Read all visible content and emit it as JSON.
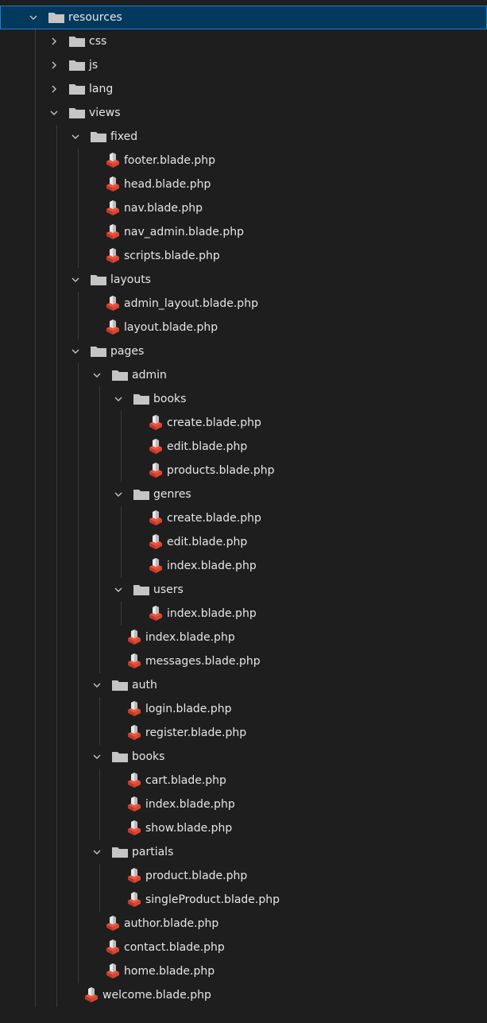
{
  "explorer": {
    "items": [
      {
        "label": "resources",
        "kind": "folder",
        "depth": 0,
        "expanded": true,
        "selected": true
      },
      {
        "label": "css",
        "kind": "folder",
        "depth": 1,
        "expanded": false
      },
      {
        "label": "js",
        "kind": "folder",
        "depth": 1,
        "expanded": false
      },
      {
        "label": "lang",
        "kind": "folder",
        "depth": 1,
        "expanded": false
      },
      {
        "label": "views",
        "kind": "folder",
        "depth": 1,
        "expanded": true
      },
      {
        "label": "fixed",
        "kind": "folder",
        "depth": 2,
        "expanded": true
      },
      {
        "label": "footer.blade.php",
        "kind": "file",
        "depth": 3
      },
      {
        "label": "head.blade.php",
        "kind": "file",
        "depth": 3
      },
      {
        "label": "nav.blade.php",
        "kind": "file",
        "depth": 3
      },
      {
        "label": "nav_admin.blade.php",
        "kind": "file",
        "depth": 3
      },
      {
        "label": "scripts.blade.php",
        "kind": "file",
        "depth": 3
      },
      {
        "label": "layouts",
        "kind": "folder",
        "depth": 2,
        "expanded": true
      },
      {
        "label": "admin_layout.blade.php",
        "kind": "file",
        "depth": 3
      },
      {
        "label": "layout.blade.php",
        "kind": "file",
        "depth": 3
      },
      {
        "label": "pages",
        "kind": "folder",
        "depth": 2,
        "expanded": true
      },
      {
        "label": "admin",
        "kind": "folder",
        "depth": 3,
        "expanded": true
      },
      {
        "label": "books",
        "kind": "folder",
        "depth": 4,
        "expanded": true
      },
      {
        "label": "create.blade.php",
        "kind": "file",
        "depth": 5
      },
      {
        "label": "edit.blade.php",
        "kind": "file",
        "depth": 5
      },
      {
        "label": "products.blade.php",
        "kind": "file",
        "depth": 5
      },
      {
        "label": "genres",
        "kind": "folder",
        "depth": 4,
        "expanded": true
      },
      {
        "label": "create.blade.php",
        "kind": "file",
        "depth": 5
      },
      {
        "label": "edit.blade.php",
        "kind": "file",
        "depth": 5
      },
      {
        "label": "index.blade.php",
        "kind": "file",
        "depth": 5
      },
      {
        "label": "users",
        "kind": "folder",
        "depth": 4,
        "expanded": true
      },
      {
        "label": "index.blade.php",
        "kind": "file",
        "depth": 5
      },
      {
        "label": "index.blade.php",
        "kind": "file",
        "depth": 4
      },
      {
        "label": "messages.blade.php",
        "kind": "file",
        "depth": 4
      },
      {
        "label": "auth",
        "kind": "folder",
        "depth": 3,
        "expanded": true
      },
      {
        "label": "login.blade.php",
        "kind": "file",
        "depth": 4
      },
      {
        "label": "register.blade.php",
        "kind": "file",
        "depth": 4
      },
      {
        "label": "books",
        "kind": "folder",
        "depth": 3,
        "expanded": true
      },
      {
        "label": "cart.blade.php",
        "kind": "file",
        "depth": 4
      },
      {
        "label": "index.blade.php",
        "kind": "file",
        "depth": 4
      },
      {
        "label": "show.blade.php",
        "kind": "file",
        "depth": 4
      },
      {
        "label": "partials",
        "kind": "folder",
        "depth": 3,
        "expanded": true
      },
      {
        "label": "product.blade.php",
        "kind": "file",
        "depth": 4
      },
      {
        "label": "singleProduct.blade.php",
        "kind": "file",
        "depth": 4
      },
      {
        "label": "author.blade.php",
        "kind": "file",
        "depth": 3
      },
      {
        "label": "contact.blade.php",
        "kind": "file",
        "depth": 3
      },
      {
        "label": "home.blade.php",
        "kind": "file",
        "depth": 3
      },
      {
        "label": "welcome.blade.php",
        "kind": "file",
        "depth": 2
      }
    ]
  },
  "icons": {
    "expanded": "chevron-down-icon",
    "collapsed": "chevron-right-icon",
    "folder": "folder-icon",
    "file": "laravel-blade-file-icon"
  },
  "colors": {
    "background": "#1e1e1e",
    "selection": "#04395e",
    "selection_border": "#1e7fd3",
    "text": "#e6e6e6",
    "folder_icon": "#c5c5c5",
    "chevron": "#c5c5c5",
    "blade_icon": "#f05340",
    "indent_guide": "#3b3b3b"
  }
}
